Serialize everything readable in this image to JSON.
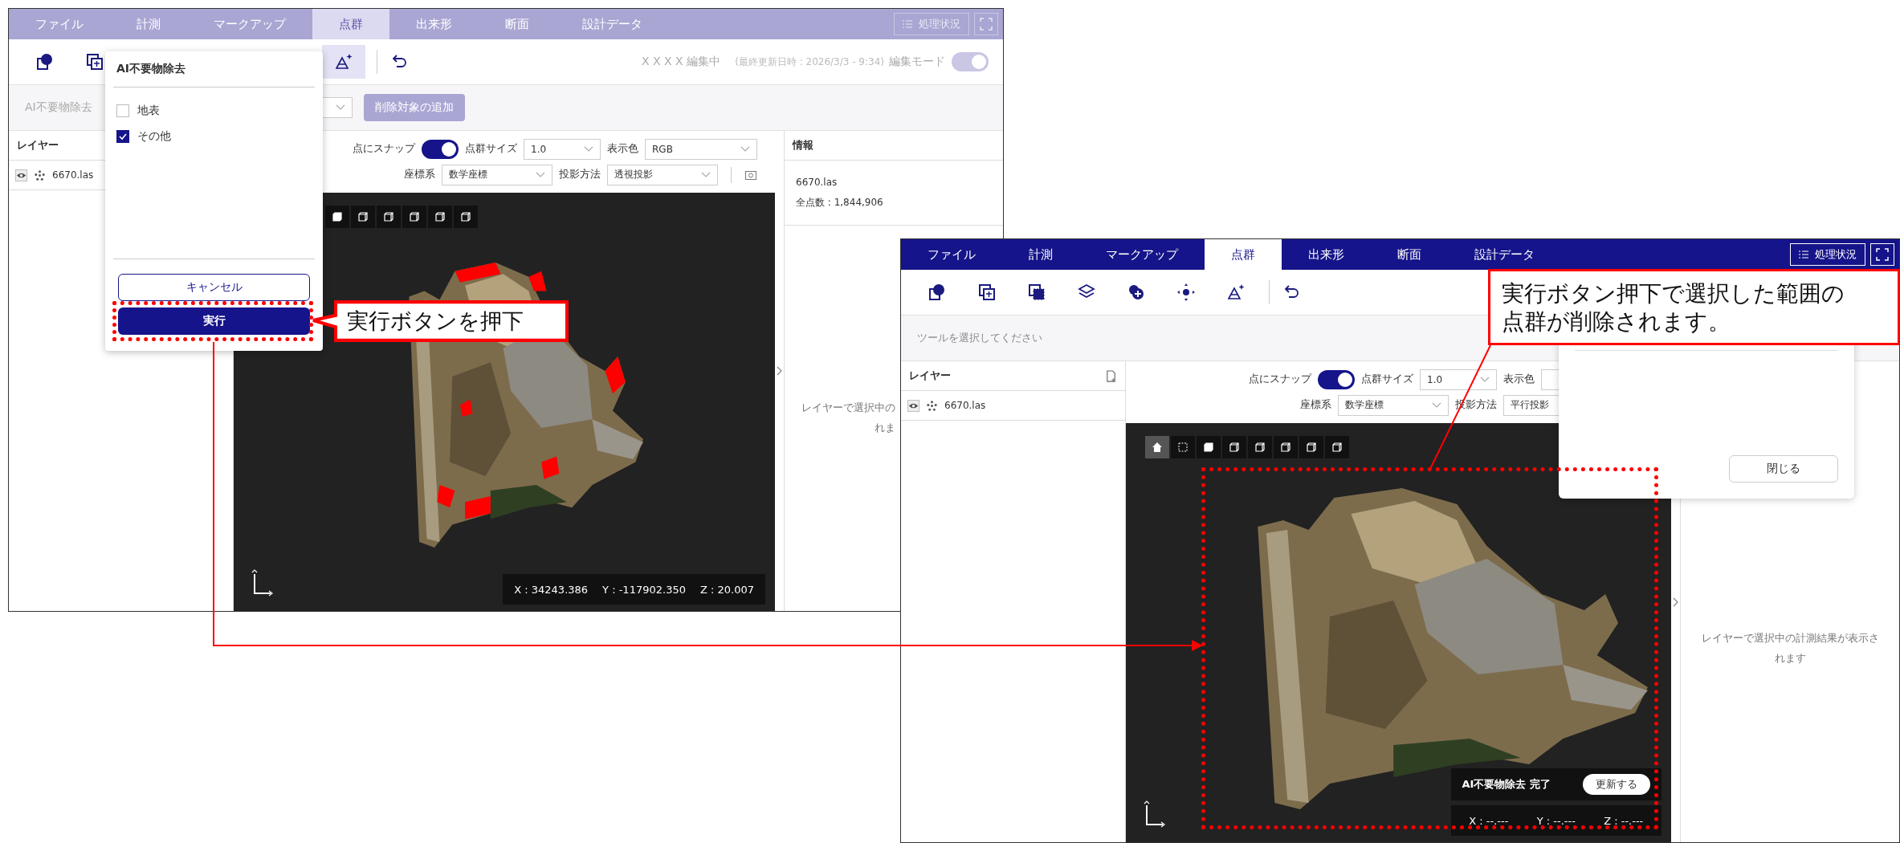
{
  "left_window": {
    "disabled": true,
    "tabs": [
      {
        "label": "ファイル",
        "selected": false
      },
      {
        "label": "計測",
        "selected": false
      },
      {
        "label": "マークアップ",
        "selected": false
      },
      {
        "label": "点群",
        "selected": true
      },
      {
        "label": "出来形",
        "selected": false
      },
      {
        "label": "断面",
        "selected": false
      },
      {
        "label": "設計データ",
        "selected": false
      }
    ],
    "status_button": "処理状況",
    "tools": [
      {
        "selected": false
      },
      {
        "selected": false
      },
      {
        "selected": true
      }
    ],
    "edit_status": "X X X X 編集中",
    "last_updated": "(最終更新日時 : 2026/3/3 - 9:34)",
    "edit_mode": {
      "label": "編集モード",
      "on": true
    },
    "tool_row": {
      "label": "AI不要物除去",
      "add_button": "削除対象の追加"
    },
    "layers": {
      "title": "レイヤー",
      "items": [
        {
          "name": "6670.las"
        }
      ]
    },
    "viewer": {
      "snap": {
        "label": "点にスナップ",
        "on": true
      },
      "size": {
        "label": "点群サイズ",
        "value": "1.0"
      },
      "color": {
        "label": "表示色",
        "value": "RGB"
      },
      "coordinate_system": {
        "label": "座標系",
        "value": "数学座標"
      },
      "projection": {
        "label": "投影方法",
        "value": "透視投影"
      },
      "view_buttons": [
        {
          "selected": false
        },
        {
          "selected": false
        },
        {
          "selected": false
        },
        {
          "selected": false
        },
        {
          "selected": false
        },
        {
          "selected": false
        }
      ],
      "coordinates": [
        "X : 34243.386",
        "Y : -117902.350",
        "Z : 20.007"
      ]
    },
    "info": {
      "title": "情報",
      "file": "6670.las",
      "total_points": "全点数 : 1,844,906",
      "message_lines": [
        "レイヤーで選択中の",
        "れま"
      ]
    },
    "popup": {
      "title": "AI不要物除去",
      "options": [
        {
          "label": "地表",
          "checked": false
        },
        {
          "label": "その他",
          "checked": true
        }
      ],
      "cancel_button": "キャンセル",
      "run_button": "実行"
    }
  },
  "right_window": {
    "disabled": false,
    "tabs": [
      {
        "label": "ファイル",
        "selected": false
      },
      {
        "label": "計測",
        "selected": false
      },
      {
        "label": "マークアップ",
        "selected": false
      },
      {
        "label": "点群",
        "selected": true
      },
      {
        "label": "出来形",
        "selected": false
      },
      {
        "label": "断面",
        "selected": false
      },
      {
        "label": "設計データ",
        "selected": false
      }
    ],
    "status_button": "処理状況",
    "tools": [
      {
        "selected": false
      },
      {
        "selected": false
      },
      {
        "selected": false
      },
      {
        "selected": false
      },
      {
        "selected": false
      },
      {
        "selected": false
      },
      {
        "selected": false
      }
    ],
    "tool_row": {
      "hint": "ツールを選択してください"
    },
    "layers": {
      "title": "レイヤー",
      "items": [
        {
          "name": "6670.las"
        }
      ]
    },
    "viewer": {
      "snap": {
        "label": "点にスナップ",
        "on": true
      },
      "size": {
        "label": "点群サイズ",
        "value": "1.0"
      },
      "color": {
        "label": "表示色"
      },
      "coordinate_system": {
        "label": "座標系",
        "value": "数学座標"
      },
      "projection": {
        "label": "投影方法",
        "value": "平行投影"
      },
      "view_buttons": [
        {
          "selected": true
        },
        {
          "selected": false
        },
        {
          "selected": false
        },
        {
          "selected": false
        },
        {
          "selected": false
        },
        {
          "selected": false
        },
        {
          "selected": false
        },
        {
          "selected": false
        }
      ],
      "notification": {
        "text": "AI不要物除去 完了",
        "button": "更新する"
      },
      "coordinates": [
        "X : --.---",
        "Y : --.---",
        "Z : --.---"
      ]
    },
    "info": {
      "message_lines": [
        "レイヤーで選択中の計測結果が表示さ",
        "れます"
      ]
    },
    "dialog": {
      "close_button": "閉じる"
    }
  },
  "callouts": [
    {
      "lines": [
        "実行ボタンを押下"
      ]
    },
    {
      "lines": [
        "実行ボタン押下で選択した範囲の",
        "点群が削除されます。"
      ]
    }
  ]
}
